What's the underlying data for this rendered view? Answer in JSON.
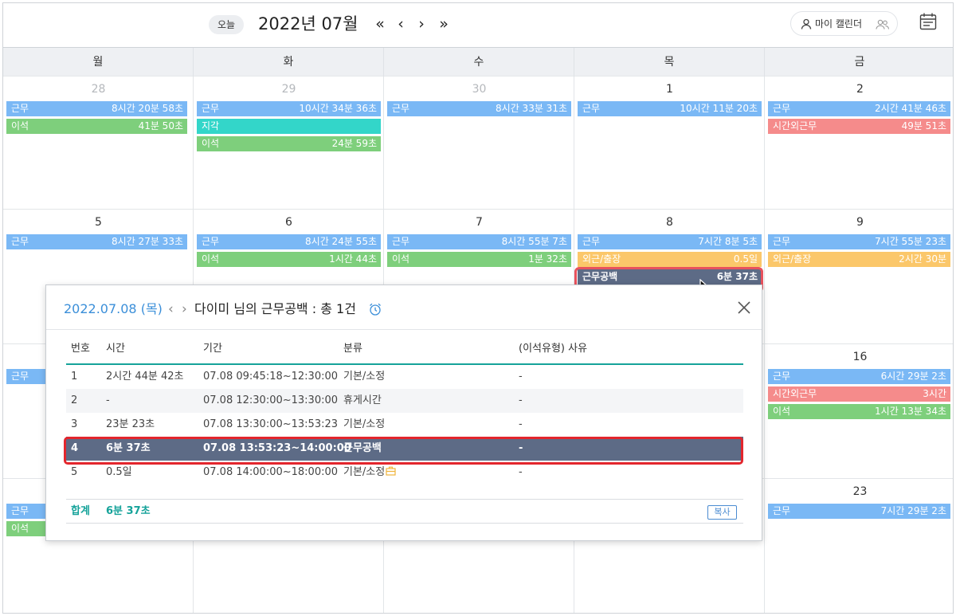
{
  "header": {
    "today_label": "오늘",
    "month_title": "2022년 07월",
    "nav": {
      "first": "«",
      "prev": "‹",
      "next": "›",
      "last": "»"
    },
    "my_calendar_label": "마이 캘린더"
  },
  "weekdays": [
    "월",
    "화",
    "수",
    "목",
    "금"
  ],
  "weeks": [
    {
      "days": [
        {
          "num": "28",
          "muted": true,
          "events": [
            {
              "label": "근무",
              "value": "8시간 20분 58초",
              "color": "blue"
            },
            {
              "label": "이석",
              "value": "41분 50초",
              "color": "green"
            }
          ]
        },
        {
          "num": "29",
          "muted": true,
          "events": [
            {
              "label": "근무",
              "value": "10시간 34분 36초",
              "color": "blue"
            },
            {
              "label": "지각",
              "value": "",
              "color": "teal"
            },
            {
              "label": "이석",
              "value": "24분 59초",
              "color": "green"
            }
          ]
        },
        {
          "num": "30",
          "muted": true,
          "events": [
            {
              "label": "근무",
              "value": "8시간 33분 31초",
              "color": "blue"
            }
          ]
        },
        {
          "num": "1",
          "muted": false,
          "events": [
            {
              "label": "근무",
              "value": "10시간 11분 20초",
              "color": "blue"
            }
          ]
        },
        {
          "num": "2",
          "muted": false,
          "events": [
            {
              "label": "근무",
              "value": "2시간 41분 46초",
              "color": "blue"
            },
            {
              "label": "시간외근무",
              "value": "49분 51초",
              "color": "red"
            }
          ]
        }
      ]
    },
    {
      "days": [
        {
          "num": "5",
          "muted": false,
          "events": [
            {
              "label": "근무",
              "value": "8시간 27분 33초",
              "color": "blue"
            }
          ]
        },
        {
          "num": "6",
          "muted": false,
          "events": [
            {
              "label": "근무",
              "value": "8시간 24분 55초",
              "color": "blue"
            },
            {
              "label": "이석",
              "value": "1시간 44초",
              "color": "green"
            }
          ]
        },
        {
          "num": "7",
          "muted": false,
          "events": [
            {
              "label": "근무",
              "value": "8시간 55분 7초",
              "color": "blue"
            },
            {
              "label": "이석",
              "value": "1분 32초",
              "color": "green"
            }
          ]
        },
        {
          "num": "8",
          "muted": false,
          "events": [
            {
              "label": "근무",
              "value": "7시간 8분 5초",
              "color": "blue"
            },
            {
              "label": "외근/출장",
              "value": "0.5일",
              "color": "orange"
            },
            {
              "label": "근무공백",
              "value": "6분 37초",
              "color": "dark"
            }
          ]
        },
        {
          "num": "9",
          "muted": false,
          "events": [
            {
              "label": "근무",
              "value": "7시간 55분 23초",
              "color": "blue"
            },
            {
              "label": "외근/출장",
              "value": "2시간 30분",
              "color": "orange"
            }
          ]
        }
      ]
    },
    {
      "days": [
        {
          "num": "",
          "muted": false,
          "events": [
            {
              "label": "근무",
              "value": "",
              "color": "blue"
            }
          ]
        },
        {
          "num": "",
          "muted": false,
          "events": []
        },
        {
          "num": "",
          "muted": false,
          "events": []
        },
        {
          "num": "",
          "muted": false,
          "events": []
        },
        {
          "num": "16",
          "muted": false,
          "events": [
            {
              "label": "근무",
              "value": "6시간 29분 2초",
              "color": "blue"
            },
            {
              "label": "시간외근무",
              "value": "3시간",
              "color": "red"
            },
            {
              "label": "이석",
              "value": "1시간 13분 34초",
              "color": "green"
            }
          ]
        }
      ]
    },
    {
      "days": [
        {
          "num": "",
          "muted": false,
          "events": [
            {
              "label": "근무",
              "value": "",
              "color": "blue"
            },
            {
              "label": "이석",
              "value": "",
              "color": "green"
            }
          ]
        },
        {
          "num": "",
          "muted": false,
          "events": []
        },
        {
          "num": "",
          "muted": false,
          "events": []
        },
        {
          "num": "",
          "muted": false,
          "events": []
        },
        {
          "num": "23",
          "muted": false,
          "events": [
            {
              "label": "근무",
              "value": "7시간 29분 2초",
              "color": "blue"
            }
          ]
        }
      ]
    }
  ],
  "modal": {
    "date": "2022.07.08 (목)",
    "prev": "‹",
    "next": "›",
    "title": "다이미 님의 근무공백 : 총 1건",
    "columns": [
      "번호",
      "시간",
      "기간",
      "분류",
      "(이석유형) 사유"
    ],
    "rows": [
      {
        "no": "1",
        "time": "2시간 44분 42초",
        "period": "07.08 09:45:18~12:30:00",
        "category": "기본/소정",
        "reason": "-"
      },
      {
        "no": "2",
        "time": "-",
        "period": "07.08 12:30:00~13:30:00",
        "category": "휴게시간",
        "reason": "-"
      },
      {
        "no": "3",
        "time": "23분 23초",
        "period": "07.08 13:30:00~13:53:23",
        "category": "기본/소정",
        "reason": "-"
      },
      {
        "no": "4",
        "time": "6분 37초",
        "period": "07.08 13:53:23~14:00:00",
        "category": "근무공백",
        "reason": "-"
      },
      {
        "no": "5",
        "time": "0.5일",
        "period": "07.08 14:00:00~18:00:00",
        "category": "기본/소정",
        "reason": "-"
      }
    ],
    "selected_row": 4,
    "sum_label": "합계",
    "sum_value": "6분 37초",
    "copy_label": "복사"
  }
}
